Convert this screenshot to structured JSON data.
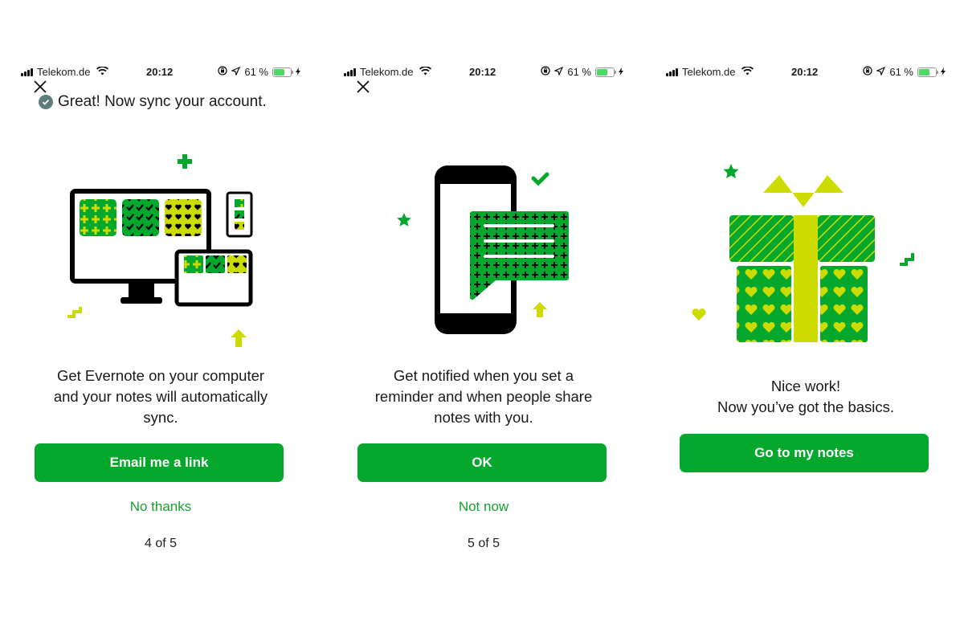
{
  "colors": {
    "accent": "#05a82d",
    "lime": "#cddc00",
    "link": "#16a32c",
    "battery": "#4cd964"
  },
  "status_bar": {
    "carrier": "Telekom.de",
    "time": "20:12",
    "battery_text": "61 %",
    "battery_level": 0.61
  },
  "screens": [
    {
      "toast": "Great! Now sync your account.",
      "description": [
        "Get Evernote on your computer",
        "and your notes will automatically",
        "sync."
      ],
      "primary_button": "Email me a link",
      "secondary_link": "No thanks",
      "page_indicator": "4 of 5",
      "illustration": "devices-sync-illustration"
    },
    {
      "description": [
        "Get notified when you set a",
        "reminder and when people share",
        "notes with you."
      ],
      "primary_button": "OK",
      "secondary_link": "Not now",
      "page_indicator": "5 of 5",
      "illustration": "phone-notification-illustration"
    },
    {
      "description": [
        "Nice work!",
        "Now you’ve got the basics."
      ],
      "primary_button": "Go to my notes",
      "illustration": "gift-illustration"
    }
  ]
}
